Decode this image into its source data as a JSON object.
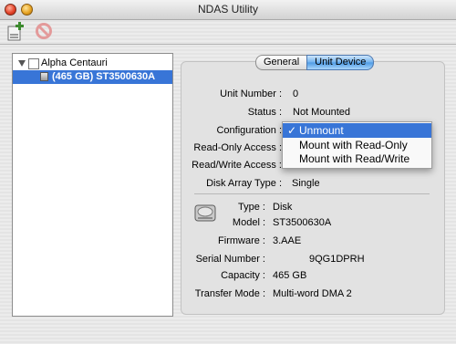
{
  "window": {
    "title": "NDAS Utility"
  },
  "toolbar": {
    "add_icon": "add-device-icon",
    "remove_icon": "remove-device-icon"
  },
  "tree": {
    "root": {
      "label": "Alpha Centauri"
    },
    "child": {
      "label": "(465 GB) ST3500630A"
    }
  },
  "tabs": [
    {
      "label": "General",
      "selected": false
    },
    {
      "label": "Unit Device",
      "selected": true
    }
  ],
  "unit": {
    "unit_number": {
      "label": "Unit Number :",
      "value": "0"
    },
    "status": {
      "label": "Status :",
      "value": "Not Mounted"
    },
    "configuration": {
      "label": "Configuration :"
    },
    "read_only_access": {
      "label": "Read-Only Access :"
    },
    "read_write_access": {
      "label": "Read/Write Access :"
    },
    "disk_array_type": {
      "label": "Disk Array Type :",
      "value": "Single"
    }
  },
  "disk": {
    "type": {
      "label": "Type :",
      "value": "Disk"
    },
    "model": {
      "label": "Model :",
      "value": "ST3500630A"
    },
    "firmware": {
      "label": "Firmware :",
      "value": "3.AAE"
    },
    "serial_number": {
      "label": "Serial Number :",
      "value": "9QG1DPRH"
    },
    "capacity": {
      "label": "Capacity :",
      "value": "465 GB"
    },
    "transfer_mode": {
      "label": "Transfer Mode :",
      "value": "Multi-word DMA 2"
    }
  },
  "configuration_menu": {
    "check": "✓",
    "options": [
      "Unmount",
      "Mount with Read-Only",
      "Mount with Read/Write"
    ],
    "selected_index": 0
  },
  "colors": {
    "selection": "#3875d7",
    "tab_selected": "#6db0ef"
  }
}
